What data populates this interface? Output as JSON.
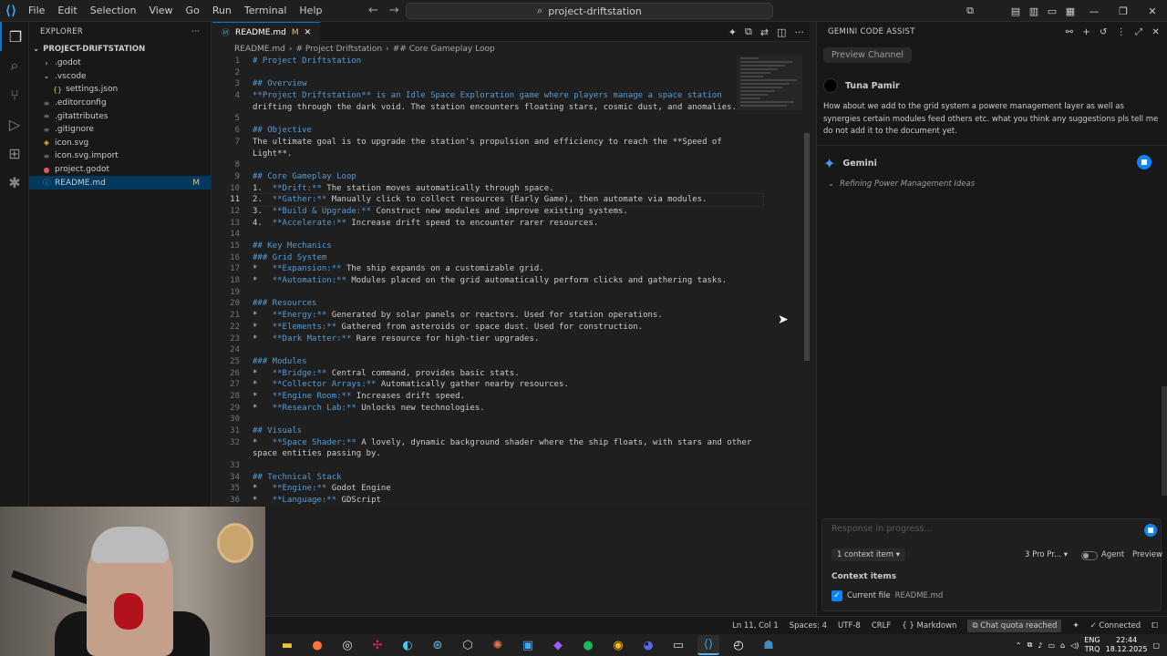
{
  "menu": [
    "File",
    "Edit",
    "Selection",
    "View",
    "Go",
    "Run",
    "Terminal",
    "Help"
  ],
  "search": {
    "text": "project-driftstation",
    "icon": "search-icon"
  },
  "explorer": {
    "title": "EXPLORER",
    "project": "PROJECT-DRIFTSTATION",
    "items": [
      {
        "label": ".godot",
        "type": "folder",
        "collapsed": true
      },
      {
        "label": ".vscode",
        "type": "folder",
        "collapsed": false
      },
      {
        "label": "settings.json",
        "type": "json",
        "indent": true
      },
      {
        "label": ".editorconfig",
        "type": "file"
      },
      {
        "label": ".gitattributes",
        "type": "file"
      },
      {
        "label": ".gitignore",
        "type": "file"
      },
      {
        "label": "icon.svg",
        "type": "svg"
      },
      {
        "label": "icon.svg.import",
        "type": "file"
      },
      {
        "label": "project.godot",
        "type": "godot"
      },
      {
        "label": "README.md",
        "type": "md",
        "badge": "M",
        "selected": true
      }
    ]
  },
  "tab": {
    "label": "README.md",
    "modified": "M"
  },
  "breadcrumb": [
    "README.md",
    "# Project Driftstation",
    "## Core Gameplay Loop"
  ],
  "code_lines": [
    {
      "n": "1",
      "t": "# Project Driftstation",
      "k": "h"
    },
    {
      "n": "2",
      "t": "",
      "k": ""
    },
    {
      "n": "3",
      "t": "## Overview",
      "k": "h"
    },
    {
      "n": "4",
      "t": "**Project Driftstation** is an Idle Space Exploration game where players manage a space station",
      "k": "b"
    },
    {
      "n": "",
      "t": "drifting through the dark void. The station encounters floating stars, cosmic dust, and anomalies.",
      "k": ""
    },
    {
      "n": "5",
      "t": "",
      "k": ""
    },
    {
      "n": "6",
      "t": "## Objective",
      "k": "h"
    },
    {
      "n": "7",
      "t": "The ultimate goal is to upgrade the station's propulsion and efficiency to reach the **Speed of",
      "k": ""
    },
    {
      "n": "",
      "t": "Light**.",
      "k": ""
    },
    {
      "n": "8",
      "t": "",
      "k": ""
    },
    {
      "n": "9",
      "t": "## Core Gameplay Loop",
      "k": "h"
    },
    {
      "n": "10",
      "t": "1.  **Drift:** The station moves automatically through space.",
      "k": ""
    },
    {
      "n": "11",
      "t": "2.  **Gather:** Manually click to collect resources (Early Game), then automate via modules.",
      "k": "",
      "cur": true
    },
    {
      "n": "12",
      "t": "3.  **Build & Upgrade:** Construct new modules and improve existing systems.",
      "k": ""
    },
    {
      "n": "13",
      "t": "4.  **Accelerate:** Increase drift speed to encounter rarer resources.",
      "k": ""
    },
    {
      "n": "14",
      "t": "",
      "k": ""
    },
    {
      "n": "15",
      "t": "## Key Mechanics",
      "k": "h"
    },
    {
      "n": "16",
      "t": "### Grid System",
      "k": "h"
    },
    {
      "n": "17",
      "t": "*   **Expansion:** The ship expands on a customizable grid.",
      "k": ""
    },
    {
      "n": "18",
      "t": "*   **Automation:** Modules placed on the grid automatically perform clicks and gathering tasks.",
      "k": ""
    },
    {
      "n": "19",
      "t": "",
      "k": ""
    },
    {
      "n": "20",
      "t": "### Resources",
      "k": "h"
    },
    {
      "n": "21",
      "t": "*   **Energy:** Generated by solar panels or reactors. Used for station operations.",
      "k": ""
    },
    {
      "n": "22",
      "t": "*   **Elements:** Gathered from asteroids or space dust. Used for construction.",
      "k": ""
    },
    {
      "n": "23",
      "t": "*   **Dark Matter:** Rare resource for high-tier upgrades.",
      "k": ""
    },
    {
      "n": "24",
      "t": "",
      "k": ""
    },
    {
      "n": "25",
      "t": "### Modules",
      "k": "h"
    },
    {
      "n": "26",
      "t": "*   **Bridge:** Central command, provides basic stats.",
      "k": ""
    },
    {
      "n": "27",
      "t": "*   **Collector Arrays:** Automatically gather nearby resources.",
      "k": ""
    },
    {
      "n": "28",
      "t": "*   **Engine Room:** Increases drift speed.",
      "k": ""
    },
    {
      "n": "29",
      "t": "*   **Research Lab:** Unlocks new technologies.",
      "k": ""
    },
    {
      "n": "30",
      "t": "",
      "k": ""
    },
    {
      "n": "31",
      "t": "## Visuals",
      "k": "h"
    },
    {
      "n": "32",
      "t": "*   **Space Shader:** A lovely, dynamic background shader where the ship floats, with stars and other",
      "k": ""
    },
    {
      "n": "",
      "t": "space entities passing by.",
      "k": ""
    },
    {
      "n": "33",
      "t": "",
      "k": ""
    },
    {
      "n": "34",
      "t": "## Technical Stack",
      "k": "h"
    },
    {
      "n": "35",
      "t": "*   **Engine:** Godot Engine",
      "k": ""
    },
    {
      "n": "36",
      "t": "*   **Language:** GDScript",
      "k": ""
    }
  ],
  "gemini": {
    "title": "GEMINI CODE ASSIST",
    "channel": "Preview Channel",
    "user_name": "Tuna Pamir",
    "user_message": "How about we add to the grid system a powere management layer as well as synergies certain modules feed others etc. what you think any suggestions pls tell me do not add it to the document yet.",
    "assistant_name": "Gemini",
    "thinking": "Refining Power Management Ideas",
    "input_placeholder": "Response in progress...",
    "context_button": "1 context item",
    "model": "3 Pro Pr...",
    "agent": "Agent",
    "preview": "Preview",
    "context_title": "Context items",
    "context_file_label": "Current file",
    "context_file_name": "README.md"
  },
  "status": {
    "position": "Ln 11, Col 1",
    "spaces": "Spaces: 4",
    "encoding": "UTF-8",
    "eol": "CRLF",
    "language": "Markdown",
    "quota": "Chat quota reached",
    "connection": "Connected"
  },
  "taskbar": {
    "lang1": "ENG",
    "lang2": "TRQ",
    "time": "22:44",
    "date": "18.12.2025"
  },
  "colors": {
    "accent": "#0078d4",
    "keyword": "#569cd6",
    "modified": "#e2c08d"
  }
}
